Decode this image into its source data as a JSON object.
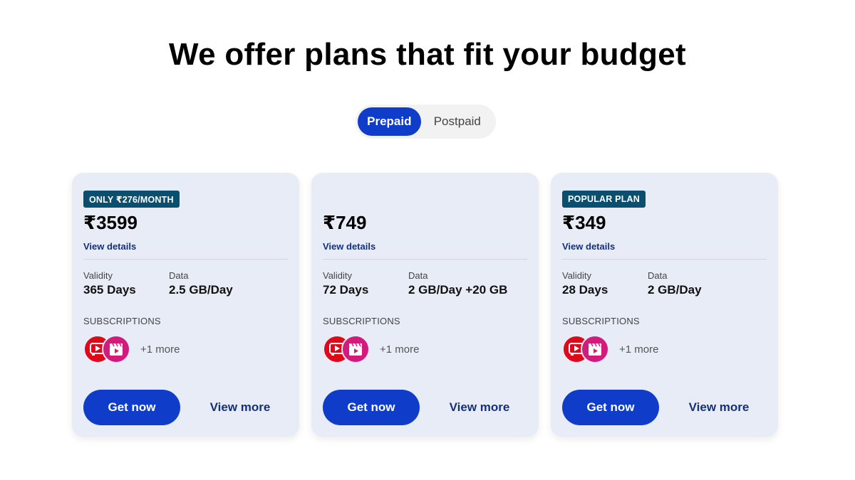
{
  "heading": "We offer plans that fit your budget",
  "toggle": {
    "prepaid": "Prepaid",
    "postpaid": "Postpaid",
    "selected": "Prepaid"
  },
  "colors": {
    "accent": "#0f3cc9",
    "card_bg": "#e8ecf7",
    "badge_bg": "#0b4f6e",
    "link": "#15307a"
  },
  "cards": [
    {
      "badge": "ONLY ₹276/MONTH",
      "price": "₹3599",
      "details_link": "View details",
      "validity_label": "Validity",
      "validity": "365 Days",
      "data_label": "Data",
      "data": "2.5 GB/Day",
      "subs_label": "SUBSCRIPTIONS",
      "subs_icons": [
        "youtube-play-icon",
        "clapper-icon"
      ],
      "subs_more": "+1 more",
      "get_label": "Get now",
      "more_label": "View more"
    },
    {
      "badge": "",
      "price": "₹749",
      "details_link": "View details",
      "validity_label": "Validity",
      "validity": "72 Days",
      "data_label": "Data",
      "data": "2 GB/Day +20 GB",
      "subs_label": "SUBSCRIPTIONS",
      "subs_icons": [
        "youtube-play-icon",
        "clapper-icon"
      ],
      "subs_more": "+1 more",
      "get_label": "Get now",
      "more_label": "View more"
    },
    {
      "badge": "POPULAR PLAN",
      "price": "₹349",
      "details_link": "View details",
      "validity_label": "Validity",
      "validity": "28 Days",
      "data_label": "Data",
      "data": "2 GB/Day",
      "subs_label": "SUBSCRIPTIONS",
      "subs_icons": [
        "youtube-play-icon",
        "clapper-icon"
      ],
      "subs_more": "+1 more",
      "get_label": "Get now",
      "more_label": "View more"
    }
  ]
}
